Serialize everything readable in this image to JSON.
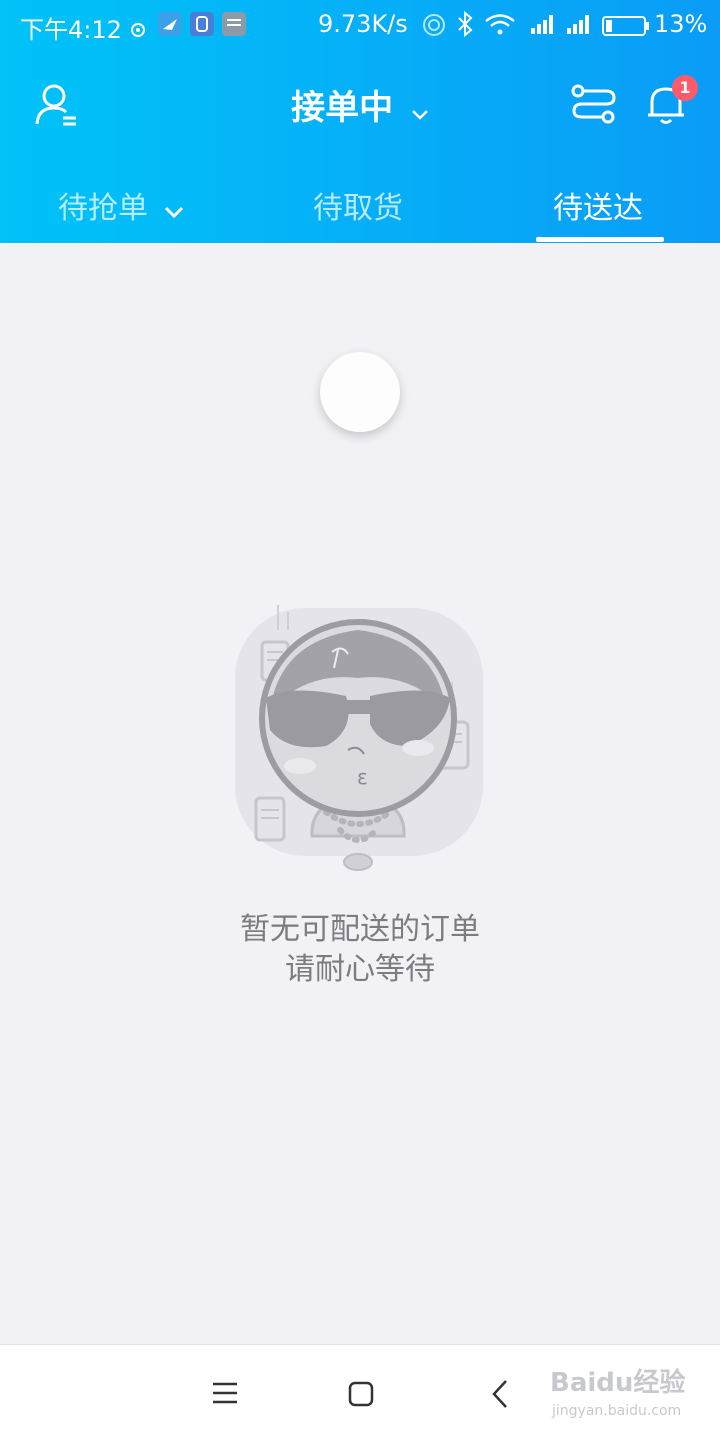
{
  "status_bar": {
    "time": "下午4:12",
    "net_speed": "9.73K/s",
    "battery": "13%",
    "icons": [
      "location-icon",
      "app-icon-plane",
      "app-icon-q",
      "app-icon-notes",
      "hotspot-icon",
      "bluetooth-icon",
      "wifi-icon",
      "signal-icon",
      "signal-icon-2",
      "battery-icon"
    ]
  },
  "header": {
    "title": "接单中",
    "badge_count": "1",
    "accent": "#00c3f7"
  },
  "tabs": [
    {
      "label": "待抢单",
      "active": false
    },
    {
      "label": "待取货",
      "active": false
    },
    {
      "label": "待送达",
      "active": true
    }
  ],
  "empty_state": {
    "line1": "暂无可配送的订单",
    "line2": "请耐心等待"
  },
  "watermark": {
    "logo": "Baidu经验",
    "url": "jingyan.baidu.com"
  }
}
